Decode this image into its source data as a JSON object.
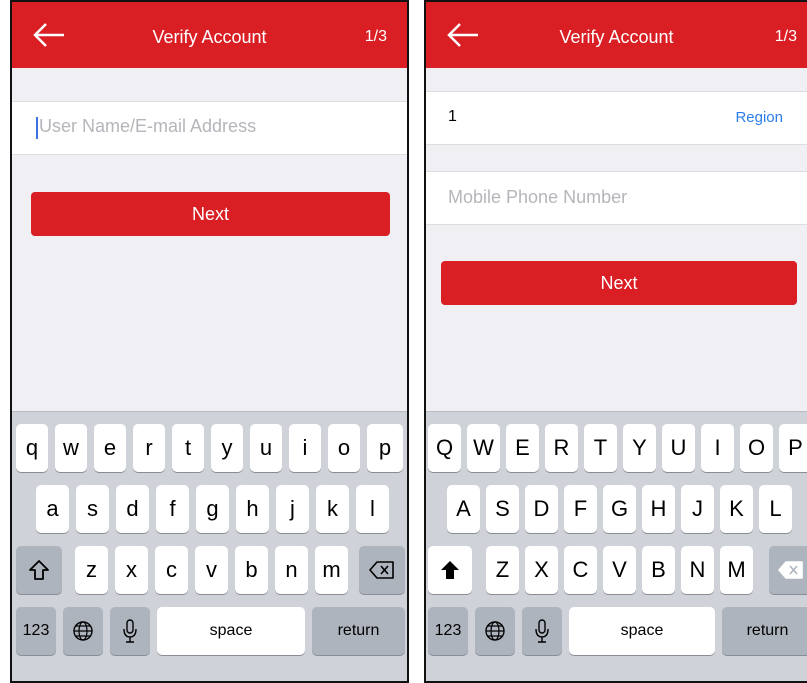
{
  "left": {
    "nav": {
      "title": "Verify Account",
      "step": "1/3"
    },
    "username_field": {
      "placeholder": "User Name/E-mail Address"
    },
    "next_label": "Next",
    "keyboard": {
      "row1": [
        "q",
        "w",
        "e",
        "r",
        "t",
        "y",
        "u",
        "i",
        "o",
        "p"
      ],
      "row2": [
        "a",
        "s",
        "d",
        "f",
        "g",
        "h",
        "j",
        "k",
        "l"
      ],
      "row3": [
        "z",
        "x",
        "c",
        "v",
        "b",
        "n",
        "m"
      ],
      "numbers_label": "123",
      "space_label": "space",
      "return_label": "return"
    }
  },
  "right": {
    "nav": {
      "title": "Verify Account",
      "step": "1/3"
    },
    "country_code": "1",
    "region_label": "Region",
    "phone_field": {
      "placeholder": "Mobile Phone Number"
    },
    "next_label": "Next",
    "keyboard": {
      "row1": [
        "Q",
        "W",
        "E",
        "R",
        "T",
        "Y",
        "U",
        "I",
        "O",
        "P"
      ],
      "row2": [
        "A",
        "S",
        "D",
        "F",
        "G",
        "H",
        "J",
        "K",
        "L"
      ],
      "row3": [
        "Z",
        "X",
        "C",
        "V",
        "B",
        "N",
        "M"
      ],
      "numbers_label": "123",
      "space_label": "space",
      "return_label": "return"
    }
  },
  "colors": {
    "accent": "#d91e24",
    "link": "#2b7de9",
    "keyboard_bg": "#cfd3d9"
  },
  "icons": [
    "back-arrow-icon",
    "shift-icon",
    "delete-icon",
    "globe-icon",
    "microphone-icon"
  ]
}
